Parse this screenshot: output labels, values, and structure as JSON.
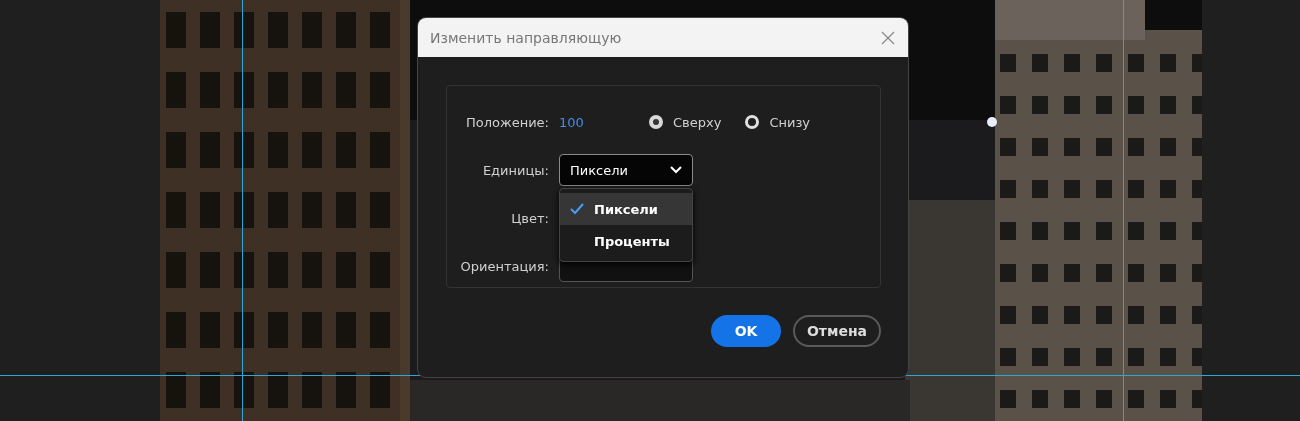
{
  "dialog": {
    "title": "Изменить направляющую"
  },
  "position": {
    "label": "Положение:",
    "value": "100"
  },
  "anchor_options": [
    {
      "label": "Сверху",
      "selected": true
    },
    {
      "label": "Снизу",
      "selected": false
    }
  ],
  "units": {
    "label": "Единицы:",
    "value": "Пиксели",
    "expanded": true
  },
  "units_menu": [
    {
      "label": "Пиксели",
      "selected": true
    },
    {
      "label": "Проценты",
      "selected": false
    }
  ],
  "color": {
    "label": "Цвет:"
  },
  "orientation": {
    "label": "Ориентация:"
  },
  "buttons": [
    {
      "label": "OK",
      "kind": "primary"
    },
    {
      "label": "Отмена",
      "kind": "secondary"
    }
  ]
}
